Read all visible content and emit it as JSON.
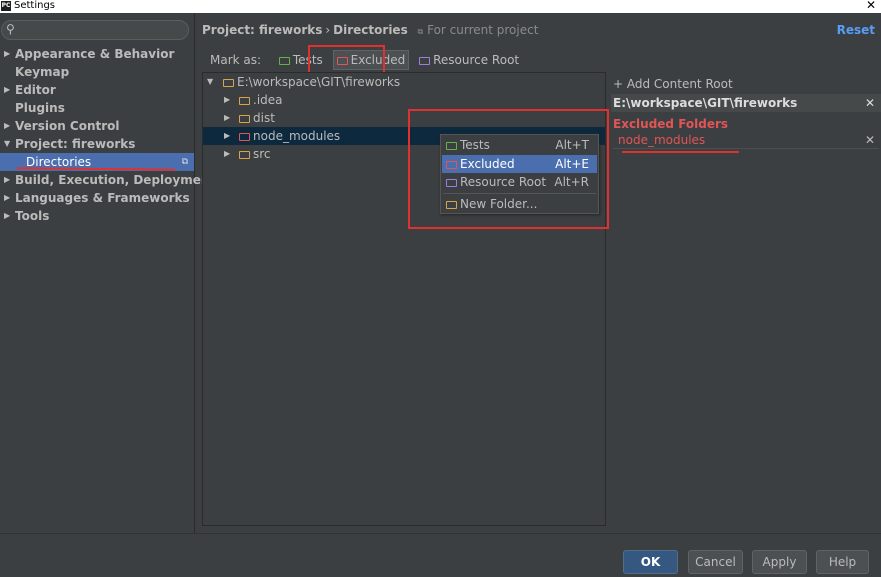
{
  "window": {
    "title": "Settings",
    "close_glyph": "✕"
  },
  "search": {
    "placeholder": ""
  },
  "nav": {
    "items": [
      {
        "label": "Appearance & Behavior",
        "arrow": "▶"
      },
      {
        "label": "Keymap",
        "arrow": ""
      },
      {
        "label": "Editor",
        "arrow": "▶"
      },
      {
        "label": "Plugins",
        "arrow": ""
      },
      {
        "label": "Version Control",
        "arrow": "▶"
      },
      {
        "label": "Project: fireworks",
        "arrow": "▼"
      },
      {
        "label": "Directories",
        "arrow": ""
      },
      {
        "label": "Build, Execution, Deployment",
        "arrow": "▶"
      },
      {
        "label": "Languages & Frameworks",
        "arrow": "▶"
      },
      {
        "label": "Tools",
        "arrow": "▶"
      }
    ]
  },
  "header": {
    "project": "Project: fireworks",
    "separator": "›",
    "page": "Directories",
    "scope": "For current project",
    "reset": "Reset"
  },
  "mark_as": {
    "label": "Mark as:",
    "tests": "Tests",
    "excluded": "Excluded",
    "resource_root": "Resource Root"
  },
  "tree": {
    "root": "E:\\workspace\\GIT\\fireworks",
    "children": [
      ".idea",
      "dist",
      "node_modules",
      "src"
    ]
  },
  "context_menu": {
    "items": [
      {
        "label": "Tests",
        "shortcut": "Alt+T"
      },
      {
        "label": "Excluded",
        "shortcut": "Alt+E"
      },
      {
        "label": "Resource Root",
        "shortcut": "Alt+R"
      },
      {
        "label": "New Folder...",
        "shortcut": ""
      }
    ]
  },
  "content_root": {
    "add_label": "+ Add Content Root",
    "path": "E:\\workspace\\GIT\\fireworks",
    "excluded_title": "Excluded Folders",
    "excluded_items": [
      "node_modules"
    ],
    "remove_glyph": "✕"
  },
  "buttons": {
    "ok": "OK",
    "cancel": "Cancel",
    "apply": "Apply",
    "help": "Help"
  },
  "colors": {
    "accent": "#4b6eaf",
    "excluded": "#e05555",
    "annotation": "#e0312e",
    "link": "#589df6"
  }
}
